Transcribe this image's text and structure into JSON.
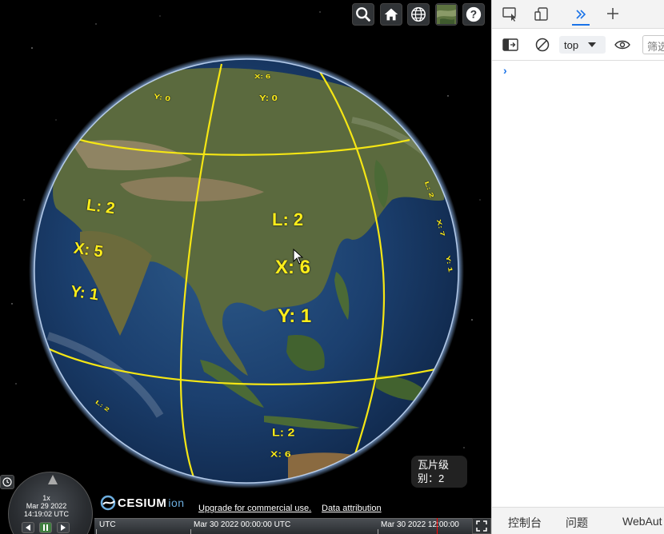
{
  "toolbar": {
    "buttons": [
      {
        "name": "search-icon"
      },
      {
        "name": "home-icon"
      },
      {
        "name": "globe-icon"
      },
      {
        "name": "imagery-layer-icon"
      },
      {
        "name": "help-icon"
      }
    ]
  },
  "globe": {
    "tile_labels": {
      "center_l": "L: 2",
      "center_x": "X: 6",
      "center_y": "Y: 1",
      "left_l": "L: 2",
      "left_x": "X: 5",
      "left_y": "Y: 1",
      "top_x": "X: 6",
      "top_y": "Y: 0",
      "top_left_y": "Y: 0",
      "bottom_l": "L: 2",
      "bottom_x": "X: 6",
      "bottom_left_l": "L: 2",
      "right_l": "L: 2",
      "right_x": "X: 7",
      "right_y": "Y: 1"
    },
    "line_color": "#f5e614",
    "label_color": "#ffee1a"
  },
  "tile_level_popup": {
    "line1": "瓦片级",
    "line2": "别：2"
  },
  "animation": {
    "speed": "1x",
    "date": "Mar 29 2022",
    "time": "14:19:02 UTC"
  },
  "credits": {
    "logo_text": "CESIUM",
    "logo_suffix": "ion",
    "upgrade_link": "Upgrade for commercial use.",
    "attribution_link": "Data attribution"
  },
  "timeline": {
    "utc_label": "UTC",
    "tick1": "Mar 30 2022 00:00:00 UTC",
    "tick2": "Mar 30 2022 12:00:00"
  },
  "devtools": {
    "context": "top",
    "filter_placeholder": "筛选",
    "prompt": "›",
    "tabs": [
      "控制台",
      "问题",
      "WebAut"
    ]
  }
}
